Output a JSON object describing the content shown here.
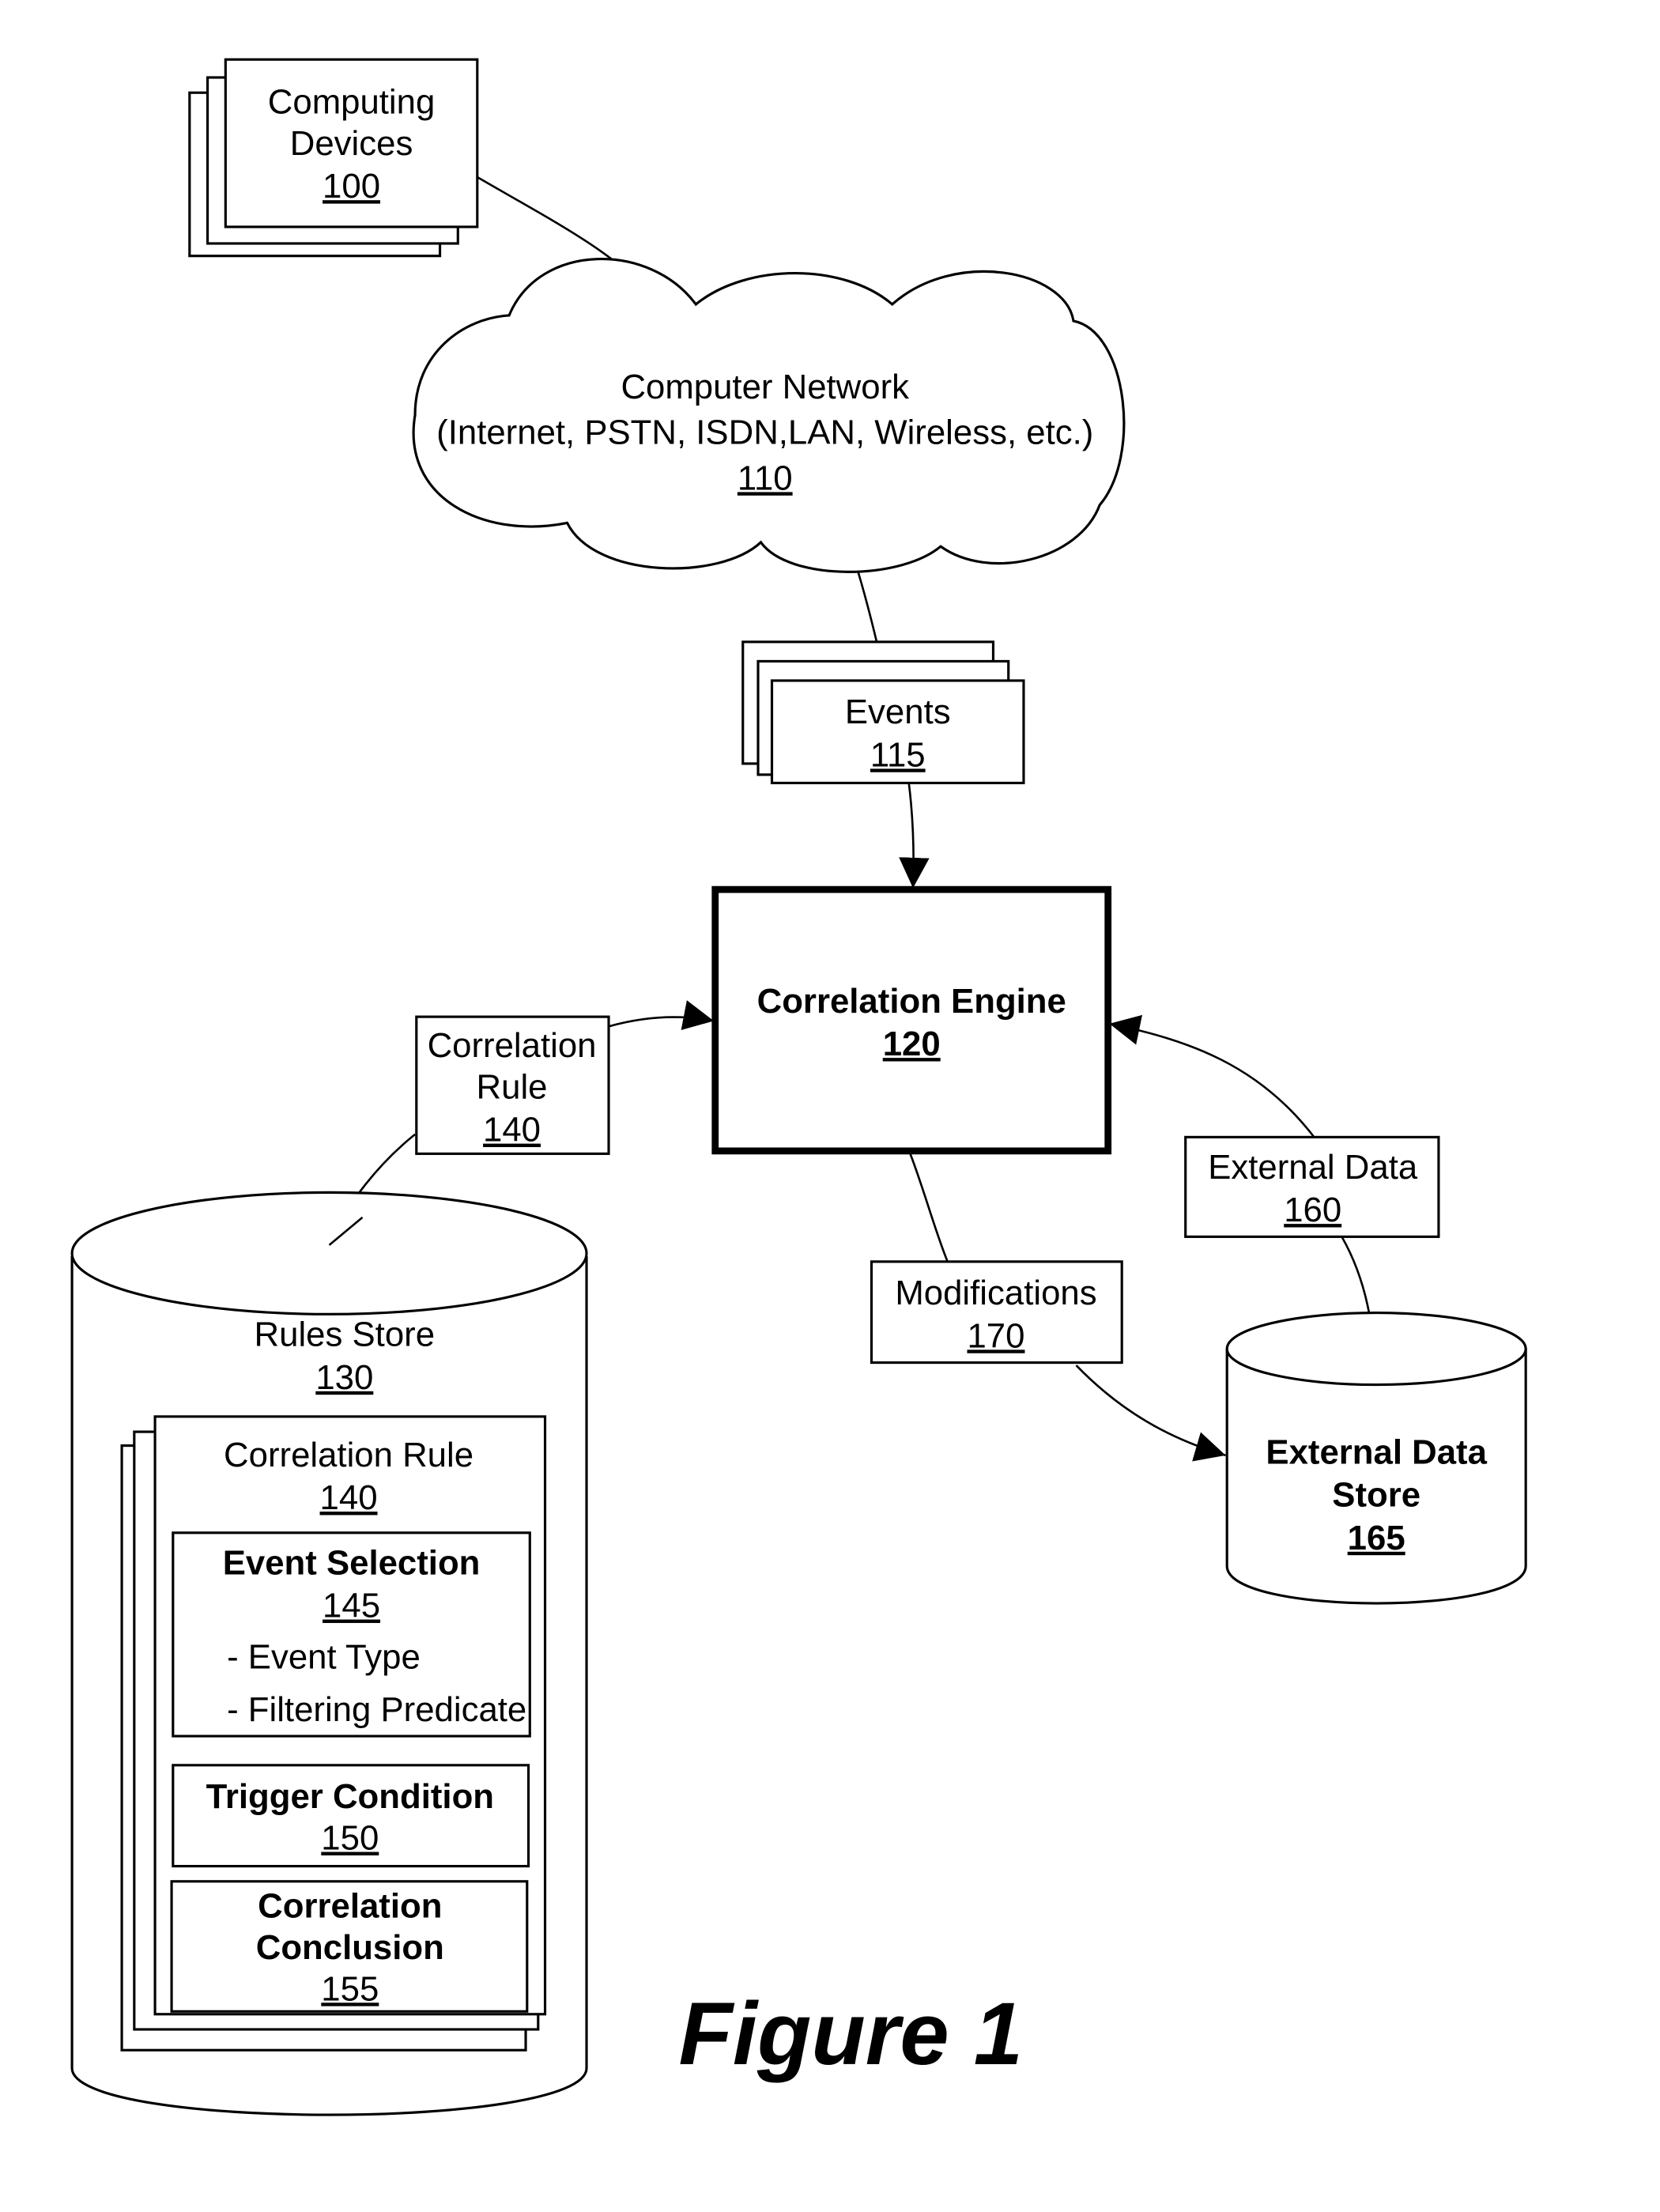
{
  "figure": {
    "title": "Figure 1"
  },
  "nodes": {
    "computing_devices": {
      "label_lines": [
        "Computing",
        "Devices"
      ],
      "ref": "100"
    },
    "computer_network": {
      "label_lines": [
        "Computer Network",
        "(Internet, PSTN, ISDN,LAN, Wireless, etc.)"
      ],
      "ref": "110"
    },
    "events": {
      "label_lines": [
        "Events"
      ],
      "ref": "115"
    },
    "correlation_engine": {
      "label_lines": [
        "Correlation Engine"
      ],
      "ref": "120"
    },
    "correlation_rule_flow": {
      "label_lines": [
        "Correlation",
        "Rule"
      ],
      "ref": "140"
    },
    "rules_store": {
      "label_lines": [
        "Rules Store"
      ],
      "ref": "130"
    },
    "correlation_rule": {
      "label_lines": [
        "Correlation Rule"
      ],
      "ref": "140"
    },
    "event_selection": {
      "label_lines": [
        "Event Selection"
      ],
      "ref": "145",
      "items": [
        "- Event Type",
        "- Filtering Predicate"
      ]
    },
    "trigger_condition": {
      "label_lines": [
        "Trigger Condition"
      ],
      "ref": "150"
    },
    "correlation_conclusion": {
      "label_lines": [
        "Correlation",
        "Conclusion"
      ],
      "ref": "155"
    },
    "external_data": {
      "label_lines": [
        "External Data"
      ],
      "ref": "160"
    },
    "modifications": {
      "label_lines": [
        "Modifications"
      ],
      "ref": "170"
    },
    "external_data_store": {
      "label_lines": [
        "External Data",
        "Store"
      ],
      "ref": "165"
    }
  },
  "edges": [
    {
      "from": "Computing Devices 100",
      "to": "Computer Network 110",
      "arrow": false
    },
    {
      "from": "Computer Network 110",
      "to": "Events 115",
      "arrow": false
    },
    {
      "from": "Events 115",
      "to": "Correlation Engine 120",
      "arrow": true
    },
    {
      "from": "Correlation Rule 140",
      "to": "Correlation Engine 120",
      "arrow": true
    },
    {
      "from": "Rules Store 130",
      "to": "Correlation Rule 140",
      "arrow": false
    },
    {
      "from": "External Data Store 165",
      "to": "Correlation Engine 120",
      "via": "External Data 160",
      "arrow": true
    },
    {
      "from": "Correlation Engine 120",
      "to": "External Data Store 165",
      "via": "Modifications 170",
      "arrow": true
    }
  ]
}
